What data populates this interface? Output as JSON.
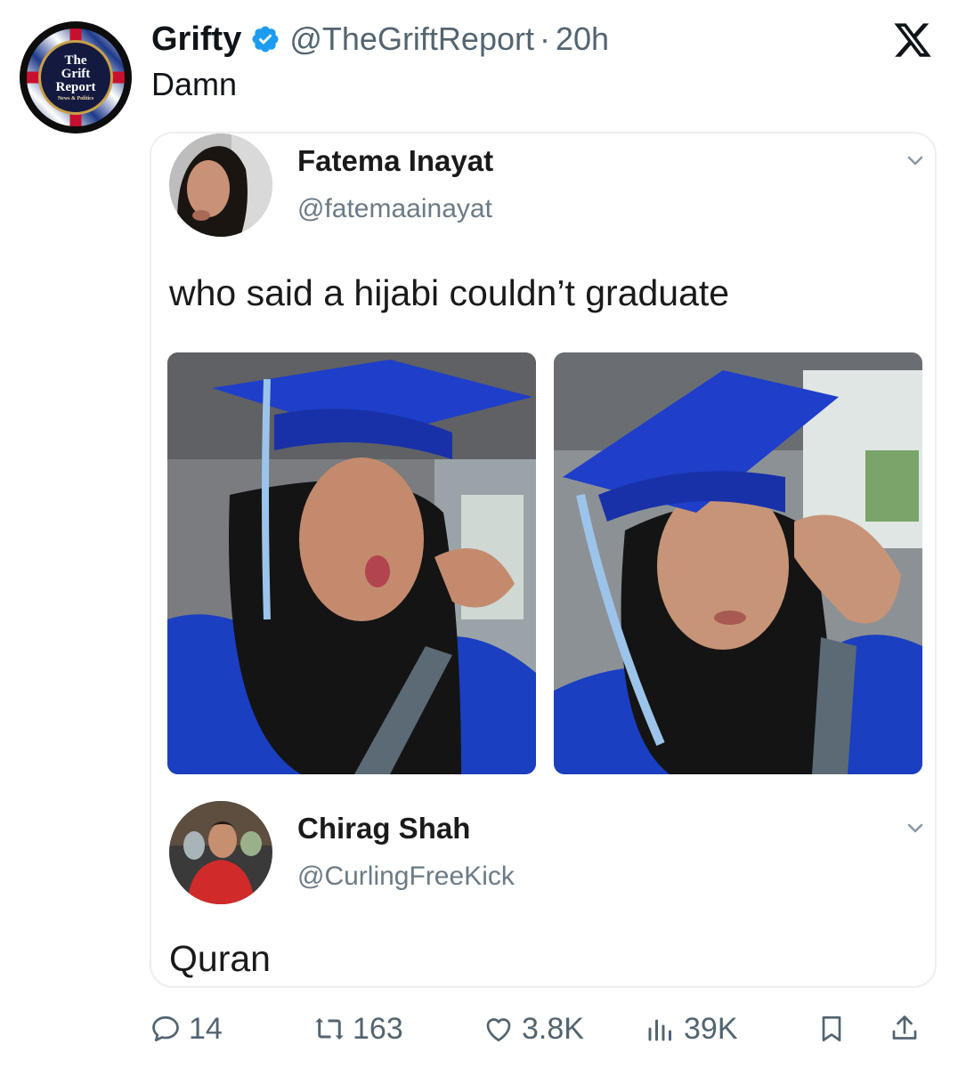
{
  "post": {
    "author_name": "Grifty",
    "author_handle": "@TheGriftReport",
    "separator": "·",
    "time": "20h",
    "text": "Damn",
    "avatar_text": {
      "line1": "The",
      "line2": "Grift",
      "line3": "Report",
      "line4": "News & Politics"
    }
  },
  "quoted": [
    {
      "name": "Fatema Inayat",
      "handle": "@fatemaainayat",
      "text": "who said a hijabi couldn’t graduate"
    },
    {
      "name": "Chirag Shah",
      "handle": "@CurlingFreeKick",
      "text": "Quran"
    }
  ],
  "actions": {
    "replies": "14",
    "reposts": "163",
    "likes": "3.8K",
    "views": "39K"
  },
  "icons": {
    "verified": "verified-badge-icon",
    "x_logo": "x-logo-icon",
    "reply": "reply-icon",
    "repost": "repost-icon",
    "like": "heart-icon",
    "views": "views-icon",
    "bookmark": "bookmark-icon",
    "share": "share-icon",
    "chevron": "chevron-down-icon"
  },
  "colors": {
    "verified_blue": "#1d9bf0",
    "text_primary": "#0f1419",
    "text_secondary": "#536471",
    "cap_blue": "#1f3ec9"
  }
}
